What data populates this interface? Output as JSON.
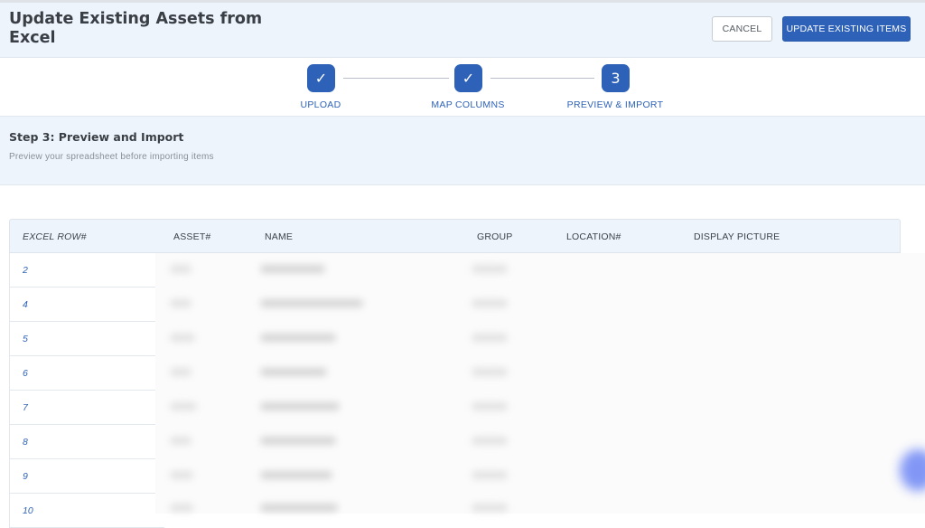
{
  "header": {
    "title": "Update Existing Assets from Excel",
    "cancel_label": "CANCEL",
    "update_label": "UPDATE EXISTING ITEMS"
  },
  "stepper": {
    "steps": [
      {
        "marker": "✓",
        "label": "UPLOAD",
        "status": "completed"
      },
      {
        "marker": "✓",
        "label": "MAP COLUMNS",
        "status": "completed"
      },
      {
        "marker": "3",
        "label": "PREVIEW & IMPORT",
        "status": "current"
      }
    ]
  },
  "section": {
    "title": "Step 3: Preview and Import",
    "description": "Preview your spreadsheet before importing items"
  },
  "table": {
    "columns": [
      "EXCEL ROW#",
      "ASSET#",
      "NAME",
      "GROUP",
      "LOCATION#",
      "DISPLAY PICTURE"
    ],
    "rows": [
      {
        "excel_row": "2"
      },
      {
        "excel_row": "4"
      },
      {
        "excel_row": "5"
      },
      {
        "excel_row": "6"
      },
      {
        "excel_row": "7"
      },
      {
        "excel_row": "8"
      },
      {
        "excel_row": "9"
      },
      {
        "excel_row": "10"
      }
    ]
  },
  "colors": {
    "accent": "#2e62b8",
    "header_bg": "#edf4fc"
  }
}
